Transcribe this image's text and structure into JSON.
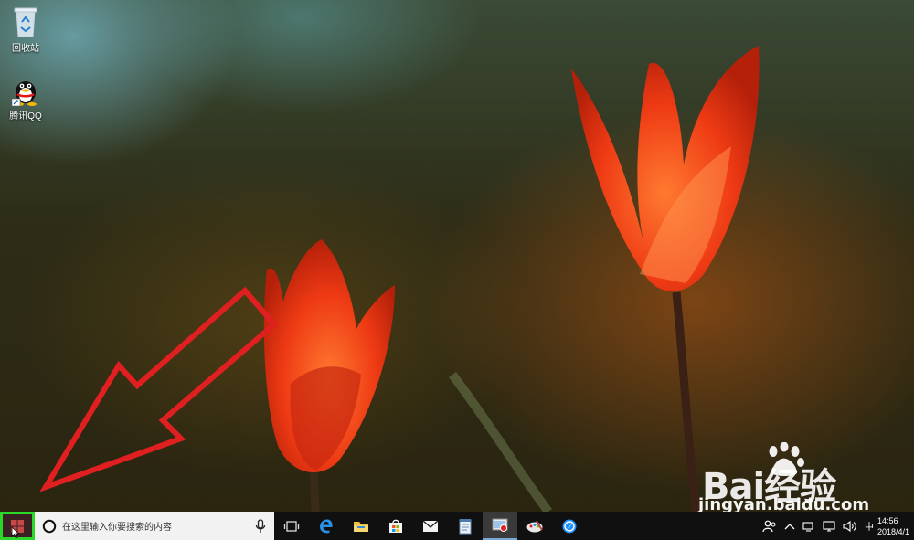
{
  "desktop": {
    "icons": [
      {
        "label": "回收站",
        "icon": "recycle-bin-icon"
      },
      {
        "label": "腾讯QQ",
        "icon": "qq-icon"
      }
    ],
    "watermark": {
      "brand": "Bai经验",
      "url": "jingyan.baidu.com"
    }
  },
  "taskbar": {
    "search_placeholder": "在这里输入你要搜索的内容",
    "pinned_apps": [
      {
        "icon": "task-view-icon"
      },
      {
        "icon": "edge-icon"
      },
      {
        "icon": "file-explorer-icon"
      },
      {
        "icon": "store-icon"
      },
      {
        "icon": "mail-icon"
      },
      {
        "icon": "notepad-icon"
      },
      {
        "icon": "screen-recorder-icon"
      },
      {
        "icon": "paint-icon"
      },
      {
        "icon": "browser-icon"
      }
    ],
    "tray": {
      "ime_label": "中",
      "time": "14:56",
      "date": "2018/4/1"
    }
  },
  "colors": {
    "start_highlight": "#2ad82a",
    "annotation_arrow": "#e02020",
    "taskbar_bg": "#101010"
  }
}
